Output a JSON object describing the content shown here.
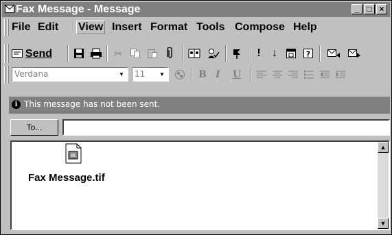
{
  "window": {
    "title": "Fax Message - Message",
    "controls": [
      "_",
      "□",
      "×"
    ]
  },
  "menu": {
    "items": [
      "File",
      "Edit",
      "View",
      "Insert",
      "Format",
      "Tools",
      "Compose",
      "Help"
    ],
    "active": "View"
  },
  "toolbar": {
    "send_label": "Send"
  },
  "format": {
    "font": "Verdana",
    "size": "11",
    "bold": "B",
    "italic": "I",
    "underline": "U"
  },
  "infobar": {
    "message": "This message has not been sent."
  },
  "compose": {
    "to_label": "To...",
    "to_value": ""
  },
  "attachment": {
    "name": "Fax Message.tif"
  }
}
